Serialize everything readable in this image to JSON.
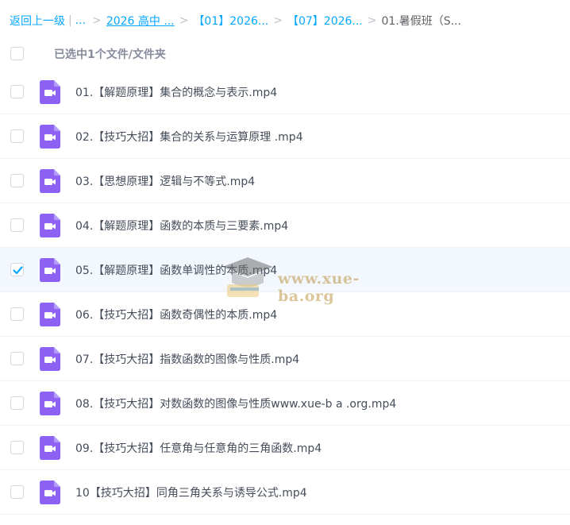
{
  "breadcrumb": {
    "back": "返回上一级",
    "ellipsis": "...",
    "items": [
      "2026 高中 ...",
      "【01】2026...",
      "【07】2026..."
    ],
    "current": "01.暑假班（S..."
  },
  "header": {
    "selection_text": "已选中1个文件/文件夹"
  },
  "files": [
    {
      "name": "01.【解题原理】集合的概念与表示.mp4",
      "selected": false,
      "icon": "video-file-icon"
    },
    {
      "name": "02.【技巧大招】集合的关系与运算原理 .mp4",
      "selected": false,
      "icon": "video-file-icon"
    },
    {
      "name": "03.【思想原理】逻辑与不等式.mp4",
      "selected": false,
      "icon": "video-file-icon"
    },
    {
      "name": "04.【解题原理】函数的本质与三要素.mp4",
      "selected": false,
      "icon": "video-file-icon"
    },
    {
      "name": "05.【解题原理】函数单调性的本质.mp4",
      "selected": true,
      "icon": "video-file-icon"
    },
    {
      "name": "06.【技巧大招】函数奇偶性的本质.mp4",
      "selected": false,
      "icon": "video-file-icon"
    },
    {
      "name": "07.【技巧大招】指数函数的图像与性质.mp4",
      "selected": false,
      "icon": "video-file-icon"
    },
    {
      "name": "08.【技巧大招】对数函数的图像与性质www.xue-b a .org.mp4",
      "selected": false,
      "icon": "video-file-icon"
    },
    {
      "name": "09.【技巧大招】任意角与任意角的三角函数.mp4",
      "selected": false,
      "icon": "video-file-icon"
    },
    {
      "name": "10【技巧大招】同角三角关系与诱导公式.mp4",
      "selected": false,
      "icon": "video-file-icon"
    }
  ],
  "watermark": {
    "text": "www.xue-ba.org"
  },
  "colors": {
    "link": "#06a7ff",
    "icon": "#8c61f4",
    "check": "#06a7ff",
    "selected_row": "#f3f8fe"
  }
}
